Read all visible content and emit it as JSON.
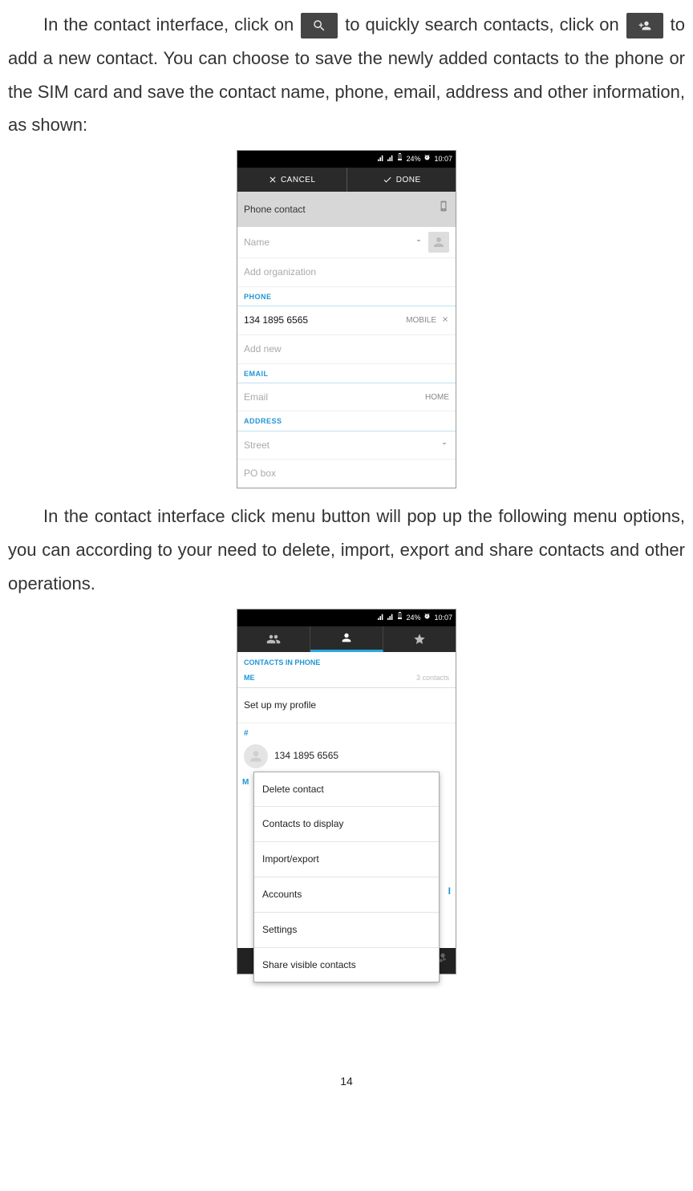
{
  "para1_a": "In the contact interface, click on ",
  "para1_b": " to quickly search contacts, click on ",
  "para1_c": " to add a new contact. You can choose to save the newly added contacts to the phone or the SIM card and save the contact name, phone, email, address and other information, as shown:",
  "status": {
    "batt": "24%",
    "time": "10:07"
  },
  "s1": {
    "cancel": "CANCEL",
    "done": "DONE",
    "account": "Phone contact",
    "name_ph": "Name",
    "addorg_ph": "Add organization",
    "phone_label": "PHONE",
    "phone_val": "134 1895 6565",
    "phone_type": "MOBILE",
    "addnew_ph": "Add new",
    "email_label": "EMAIL",
    "email_ph": "Email",
    "email_type": "HOME",
    "address_label": "ADDRESS",
    "street_ph": "Street",
    "pobox_ph": "PO box"
  },
  "para2": "In the contact interface click menu button will pop up the following menu options, you can according to your need to delete, import, export and share contacts and other operations.",
  "s2": {
    "contacts_in_phone": "CONTACTS IN PHONE",
    "me": "ME",
    "count": "3 contacts",
    "setup": "Set up my profile",
    "hash": "#",
    "contact1": "134 1895 6565",
    "menu": [
      "Delete contact",
      "Contacts to display",
      "Import/export",
      "Accounts",
      "Settings",
      "Share visible contacts"
    ],
    "side_letter": "I"
  },
  "page_number": "14"
}
